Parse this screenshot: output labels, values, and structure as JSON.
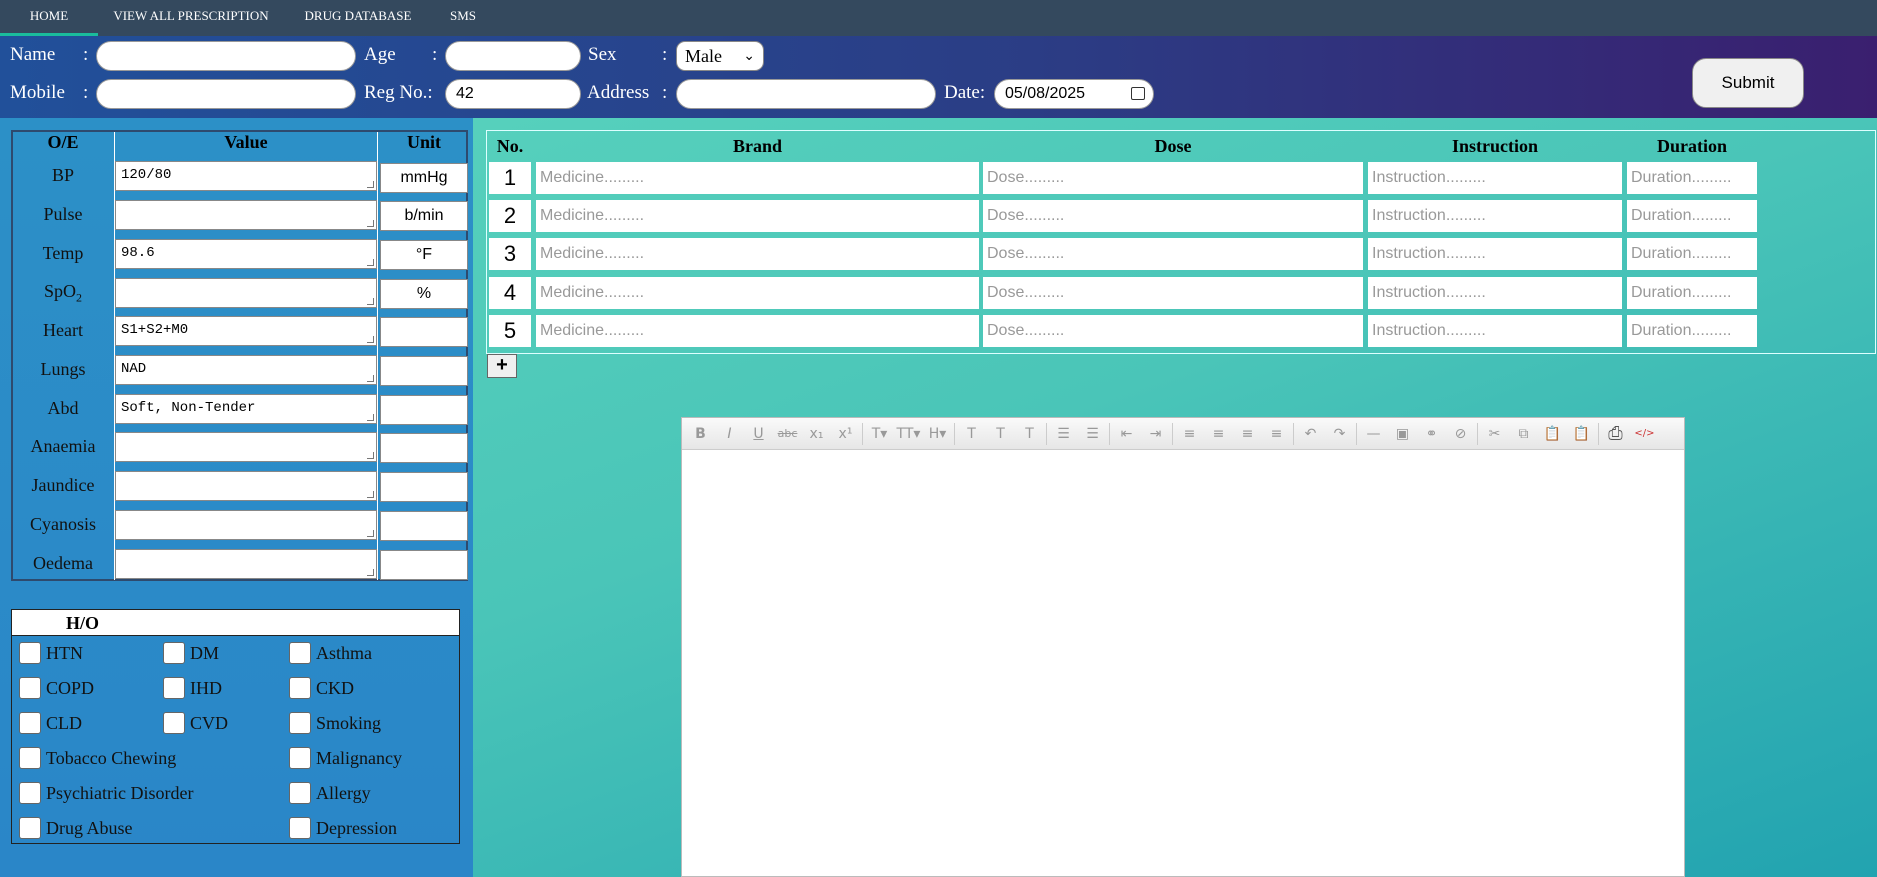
{
  "nav": {
    "items": [
      {
        "label": "HOME",
        "active": true
      },
      {
        "label": "VIEW ALL PRESCRIPTION",
        "active": false
      },
      {
        "label": "DRUG DATABASE",
        "active": false
      },
      {
        "label": "SMS",
        "active": false
      }
    ],
    "accent_color": "#1abc9c"
  },
  "patient": {
    "name_label": "Name",
    "name_colon": ":",
    "name_value": "",
    "age_label": "Age",
    "age_colon": ":",
    "age_value": "",
    "sex_label": "Sex",
    "sex_colon": ":",
    "sex_value": "Male",
    "mobile_label": "Mobile",
    "mobile_colon": ":",
    "mobile_value": "",
    "regno_label": "Reg No.:",
    "regno_value": "42",
    "address_label": "Address",
    "address_colon": ":",
    "address_value": "",
    "date_label": "Date:",
    "date_value": "05/08/2025",
    "submit_label": "Submit"
  },
  "oe": {
    "headers": [
      "O/E",
      "Value",
      "Unit"
    ],
    "rows": [
      {
        "label": "BP",
        "value": "120/80",
        "unit": "mmHg"
      },
      {
        "label": "Pulse",
        "value": "",
        "unit": "b/min"
      },
      {
        "label": "Temp",
        "value": "98.6",
        "unit": "°F"
      },
      {
        "label": "SpO",
        "sub": "2",
        "value": "",
        "unit": "%"
      },
      {
        "label": "Heart",
        "value": "S1+S2+M0",
        "unit": ""
      },
      {
        "label": "Lungs",
        "value": "NAD",
        "unit": ""
      },
      {
        "label": "Abd",
        "value": "Soft, Non-Tender",
        "unit": ""
      },
      {
        "label": "Anaemia",
        "value": "",
        "unit": ""
      },
      {
        "label": "Jaundice",
        "value": "",
        "unit": ""
      },
      {
        "label": "Cyanosis",
        "value": "",
        "unit": ""
      },
      {
        "label": "Oedema",
        "value": "",
        "unit": ""
      }
    ]
  },
  "ho": {
    "title": "H/O",
    "items": [
      "HTN",
      "DM",
      "Asthma",
      "COPD",
      "IHD",
      "CKD",
      "CLD",
      "CVD",
      "Smoking",
      "Tobacco Chewing",
      "Malignancy",
      "Psychiatric Disorder",
      "Allergy",
      "Drug Abuse",
      "Depression"
    ]
  },
  "rx": {
    "headers": [
      "No.",
      "Brand",
      "Dose",
      "Instruction",
      "Duration"
    ],
    "rows": [
      {
        "no": "1",
        "brand_ph": "Medicine.........",
        "dose_ph": "Dose.........",
        "instr_ph": "Instruction.........",
        "dur_ph": "Duration........."
      },
      {
        "no": "2",
        "brand_ph": "Medicine.........",
        "dose_ph": "Dose.........",
        "instr_ph": "Instruction.........",
        "dur_ph": "Duration........."
      },
      {
        "no": "3",
        "brand_ph": "Medicine.........",
        "dose_ph": "Dose.........",
        "instr_ph": "Instruction.........",
        "dur_ph": "Duration........."
      },
      {
        "no": "4",
        "brand_ph": "Medicine.........",
        "dose_ph": "Dose.........",
        "instr_ph": "Instruction.........",
        "dur_ph": "Duration........."
      },
      {
        "no": "5",
        "brand_ph": "Medicine.........",
        "dose_ph": "Dose.........",
        "instr_ph": "Instruction.........",
        "dur_ph": "Duration........."
      }
    ],
    "add_label": "+"
  },
  "editor": {
    "toolbar": [
      {
        "icon": "bold-icon",
        "glyph": "B"
      },
      {
        "icon": "italic-icon",
        "glyph": "I"
      },
      {
        "icon": "underline-icon",
        "glyph": "U"
      },
      {
        "icon": "strikethrough-icon",
        "glyph": "abc"
      },
      {
        "icon": "subscript-icon",
        "glyph": "x₁"
      },
      {
        "icon": "superscript-icon",
        "glyph": "x¹"
      },
      {
        "icon": "font-size-icon",
        "glyph": "T▾"
      },
      {
        "icon": "font-family-icon",
        "glyph": "TT▾"
      },
      {
        "icon": "heading-icon",
        "glyph": "H▾"
      },
      {
        "icon": "text-color-icon",
        "glyph": "T"
      },
      {
        "icon": "highlight-icon",
        "glyph": "T"
      },
      {
        "icon": "clear-format-icon",
        "glyph": "T"
      },
      {
        "icon": "bullet-list-icon",
        "glyph": "☰"
      },
      {
        "icon": "numbered-list-icon",
        "glyph": "☰"
      },
      {
        "icon": "outdent-icon",
        "glyph": "⇤"
      },
      {
        "icon": "indent-icon",
        "glyph": "⇥"
      },
      {
        "icon": "align-left-icon",
        "glyph": "≡"
      },
      {
        "icon": "align-center-icon",
        "glyph": "≡"
      },
      {
        "icon": "align-right-icon",
        "glyph": "≡"
      },
      {
        "icon": "justify-icon",
        "glyph": "≡"
      },
      {
        "icon": "undo-icon",
        "glyph": "↶"
      },
      {
        "icon": "redo-icon",
        "glyph": "↷"
      },
      {
        "icon": "horizontal-rule-icon",
        "glyph": "—"
      },
      {
        "icon": "image-icon",
        "glyph": "▣"
      },
      {
        "icon": "link-icon",
        "glyph": "⚭"
      },
      {
        "icon": "unlink-icon",
        "glyph": "⊘"
      },
      {
        "icon": "cut-icon",
        "glyph": "✂"
      },
      {
        "icon": "copy-icon",
        "glyph": "⧉"
      },
      {
        "icon": "paste-icon",
        "glyph": "📋"
      },
      {
        "icon": "paste-text-icon",
        "glyph": "📋"
      },
      {
        "icon": "print-icon",
        "glyph": "⎙"
      },
      {
        "icon": "source-code-icon",
        "glyph": "</>"
      }
    ]
  }
}
